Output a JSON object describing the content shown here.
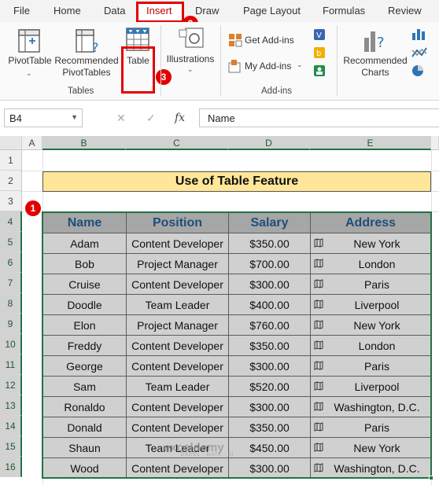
{
  "ribbon_tabs": [
    "File",
    "Home",
    "Data",
    "Insert",
    "Draw",
    "Page Layout",
    "Formulas",
    "Review"
  ],
  "active_tab": "Insert",
  "ribbon": {
    "pivot_table": "PivotTable",
    "recommended_pivot_line1": "Recommended",
    "recommended_pivot_line2": "PivotTables",
    "table": "Table",
    "illustrations": "Illustrations",
    "get_addins": "Get Add-ins",
    "my_addins": "My Add-ins",
    "recommended_charts_line1": "Recommended",
    "recommended_charts_line2": "Charts",
    "group_tables": "Tables",
    "group_addins": "Add-ins"
  },
  "badges": {
    "b1": "1",
    "b2": "2",
    "b3": "3"
  },
  "formula_bar": {
    "name_box": "B4",
    "fx": "fx",
    "content": "Name"
  },
  "columns": [
    "A",
    "B",
    "C",
    "D",
    "E"
  ],
  "rows": [
    "1",
    "2",
    "3",
    "4",
    "5",
    "6",
    "7",
    "8",
    "9",
    "10",
    "11",
    "12",
    "13",
    "14",
    "15",
    "16"
  ],
  "sheet_title": "Use of Table Feature",
  "table": {
    "headers": [
      "Name",
      "Position",
      "Salary",
      "Address"
    ],
    "rows": [
      [
        "Adam",
        "Content Developer",
        "$350.00",
        "New York"
      ],
      [
        "Bob",
        "Project Manager",
        "$700.00",
        "London"
      ],
      [
        "Cruise",
        "Content Developer",
        "$300.00",
        "Paris"
      ],
      [
        "Doodle",
        "Team Leader",
        "$400.00",
        "Liverpool"
      ],
      [
        "Elon",
        "Project Manager",
        "$760.00",
        "New York"
      ],
      [
        "Freddy",
        "Content Developer",
        "$350.00",
        "London"
      ],
      [
        "George",
        "Content Developer",
        "$300.00",
        "Paris"
      ],
      [
        "Sam",
        "Team Leader",
        "$520.00",
        "Liverpool"
      ],
      [
        "Ronaldo",
        "Content Developer",
        "$300.00",
        "Washington, D.C."
      ],
      [
        "Donald",
        "Content Developer",
        "$350.00",
        "Paris"
      ],
      [
        "Shaun",
        "Team Leader",
        "$450.00",
        "New York"
      ],
      [
        "Wood",
        "Content Developer",
        "$300.00",
        "Washington, D.C."
      ]
    ]
  },
  "watermark": {
    "brand": "exceldemy",
    "tagline": "EXCEL · DATA · BI"
  },
  "colors": {
    "accent_red": "#e00000",
    "excel_green": "#217346",
    "title_fill": "#ffe699",
    "header_text": "#1f4e79"
  }
}
